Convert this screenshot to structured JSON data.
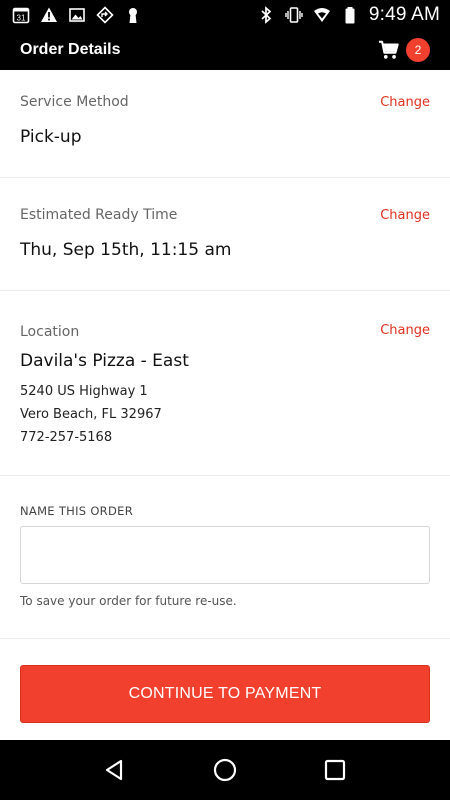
{
  "status_bar": {
    "calendar_day": "31",
    "time": "9:49 AM",
    "left_icons": [
      "calendar-icon",
      "warning-icon",
      "image-icon",
      "nav-arrow-icon",
      "keyhole-icon"
    ],
    "right_icons": [
      "bluetooth-icon",
      "vibrate-icon",
      "wifi-icon",
      "battery-icon"
    ]
  },
  "app_bar": {
    "title": "Order Details",
    "cart_count": "2"
  },
  "service_method": {
    "label": "Service Method",
    "value": "Pick-up",
    "change_label": "Change"
  },
  "ready_time": {
    "label": "Estimated Ready Time",
    "value": "Thu, Sep 15th, 11:15 am",
    "change_label": "Change"
  },
  "location": {
    "label": "Location",
    "name": "Davila's Pizza - East",
    "address_line1": "5240 US Highway 1",
    "address_line2": "Vero Beach, FL 32967",
    "phone": "772-257-5168",
    "change_label": "Change"
  },
  "order_name": {
    "label": "NAME THIS ORDER",
    "value": "",
    "placeholder": "",
    "hint": "To save your order for future re-use."
  },
  "cta": {
    "label": "CONTINUE TO PAYMENT"
  },
  "colors": {
    "accent": "#f2402f",
    "link": "#e0321f",
    "bar": "#000000"
  }
}
